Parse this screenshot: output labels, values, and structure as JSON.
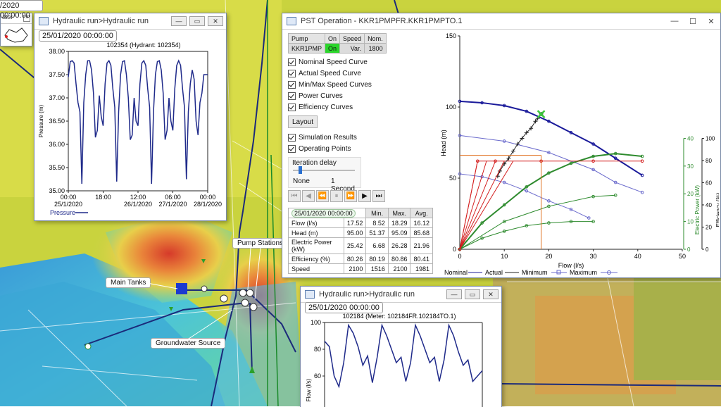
{
  "map": {
    "labels": {
      "pump_stations": "Pump Stations",
      "main_tanks": "Main Tanks",
      "groundwater_source": "Groundwater Source"
    },
    "partial_window": {
      "title_fragment": "ator",
      "date_fragment": "/2020 00:00:00"
    }
  },
  "hydrant_window": {
    "title": "Hydraulic run>Hydraulic run",
    "date": "25/01/2020 00:00:00",
    "chart_title": "102354 (Hydrant: 102354)",
    "legend": "Pressure"
  },
  "meter_window": {
    "title": "Hydraulic run>Hydraulic run",
    "date": "25/01/2020 00:00:00",
    "chart_title": "102184 (Meter: 102184FR.102184TO.1)"
  },
  "pst_window": {
    "title": "PST Operation - KKR1PMPFR.KKR1PMPTO.1",
    "pump_table": {
      "headers": [
        "Pump",
        "On",
        "Speed",
        "Nom."
      ],
      "row": [
        "KKR1PMP",
        "On",
        "Var.",
        "1800"
      ]
    },
    "checkboxes": [
      "Nominal Speed Curve",
      "Actual Speed Curve",
      "Min/Max Speed Curves",
      "Power Curves",
      "Efficiency Curves"
    ],
    "layout_button": "Layout",
    "checkboxes2": [
      "Simulation Results",
      "Operating Points"
    ],
    "iteration": {
      "label": "Iteration delay",
      "min_label": "None",
      "max_label": "1 Second",
      "value": 0.1
    },
    "results_table": {
      "date": "25/01/2020 00:00:00",
      "headers": [
        "Min.",
        "Max.",
        "Avg."
      ],
      "rows": [
        [
          "Flow (l/s)",
          "17.52",
          "8.52",
          "18.29",
          "16.12"
        ],
        [
          "Head (m)",
          "95.00",
          "51.37",
          "95.09",
          "85.68"
        ],
        [
          "Electric Power (kW)",
          "25.42",
          "6.68",
          "26.28",
          "21.96"
        ],
        [
          "Efficiency (%)",
          "80.26",
          "80.19",
          "80.86",
          "80.41"
        ],
        [
          "Speed",
          "2100",
          "1516",
          "2100",
          "1981"
        ]
      ]
    },
    "legend": {
      "nominal": "Nominal",
      "actual": "Actual",
      "minimum": "Minimum",
      "maximum": "Maximum"
    }
  },
  "colors": {
    "nominal": "#1a1a9a",
    "actual": "#222222",
    "minimum": "#6a6acc",
    "maximum": "#6a6acc",
    "power": "#2e8b2e",
    "efficiency": "#1a7a1a",
    "operating": "#d42020",
    "pressure": "#1f2a8a"
  },
  "chart_data": [
    {
      "type": "line",
      "title": "102354 (Hydrant: 102354)",
      "ylabel": "Pressure (m)",
      "ylim": [
        35.0,
        38.0
      ],
      "yticks": [
        "38.00",
        "37.50",
        "37.00",
        "36.50",
        "36.00",
        "35.50",
        "35.00"
      ],
      "xticks": [
        [
          "00:00",
          "25/1/2020"
        ],
        [
          "18:00",
          ""
        ],
        [
          "12:00",
          "26/1/2020"
        ],
        [
          "06:00",
          "27/1/2020"
        ],
        [
          "00:00",
          "28/1/2020"
        ]
      ],
      "xlim": [
        0,
        72
      ],
      "series": [
        {
          "name": "Pressure",
          "x": [
            0,
            1,
            2,
            3,
            4,
            5,
            6,
            7,
            8,
            9,
            10,
            11,
            12,
            13,
            14,
            15,
            16,
            17,
            18,
            19,
            20,
            21,
            22,
            23,
            24,
            25,
            26,
            27,
            28,
            29,
            30,
            31,
            32,
            33,
            34,
            35,
            36,
            37,
            38,
            39,
            40,
            41,
            42,
            43,
            44,
            45,
            46,
            47,
            48,
            49,
            50,
            51,
            52,
            53,
            54,
            55,
            56,
            57,
            58,
            59,
            60,
            61,
            62,
            63,
            64,
            65,
            66,
            67,
            68,
            69,
            70,
            71,
            72
          ],
          "y": [
            37.45,
            37.78,
            37.8,
            37.75,
            37.3,
            36.9,
            36.7,
            35.15,
            36.9,
            37.5,
            37.8,
            37.8,
            37.6,
            37.1,
            36.15,
            36.3,
            37.05,
            36.6,
            36.4,
            37.3,
            37.75,
            37.8,
            37.7,
            37.2,
            36.8,
            35.2,
            36.7,
            37.5,
            37.78,
            37.8,
            37.5,
            37.0,
            36.1,
            36.2,
            37.0,
            36.5,
            36.4,
            37.3,
            37.75,
            37.8,
            37.7,
            37.2,
            36.8,
            35.15,
            36.7,
            37.5,
            37.78,
            37.8,
            37.6,
            37.1,
            36.1,
            36.3,
            37.0,
            36.5,
            36.3,
            37.2,
            37.7,
            37.8,
            37.7,
            37.2,
            36.8,
            35.25,
            36.7,
            37.3,
            37.6,
            37.4,
            36.5,
            36.2,
            36.9,
            37.1,
            37.5,
            37.5,
            37.5
          ]
        }
      ]
    },
    {
      "type": "line",
      "title": "102184 (Meter: 102184FR.102184TO.1)",
      "ylabel": "Flow (l/s)",
      "ylim": [
        50,
        100
      ],
      "yticks": [
        "100",
        "80",
        "60"
      ],
      "series": [
        {
          "name": "Flow",
          "x": [
            0,
            2,
            4,
            6,
            8,
            10,
            12,
            14,
            16,
            18,
            20,
            22,
            24,
            26,
            28,
            30,
            32,
            34,
            36,
            38,
            40,
            42,
            44,
            46,
            48,
            50,
            52,
            54,
            56,
            58,
            60,
            62,
            64,
            66
          ],
          "y": [
            86,
            82,
            60,
            52,
            70,
            98,
            92,
            82,
            68,
            75,
            55,
            74,
            98,
            90,
            80,
            70,
            74,
            56,
            70,
            98,
            90,
            80,
            70,
            74,
            56,
            72,
            98,
            90,
            78,
            68,
            72,
            56,
            60,
            64
          ]
        }
      ]
    },
    {
      "type": "line",
      "xlabel": "Flow (l/s)",
      "ylabel": "Head (m)",
      "y2label": "Electric Power (kW)",
      "y3label": "Efficiency (%)",
      "xlim": [
        0,
        50
      ],
      "ylim": [
        0,
        150
      ],
      "y2lim": [
        0,
        40
      ],
      "y3lim": [
        0,
        100
      ],
      "xticks": [
        0,
        10,
        20,
        30,
        40,
        50
      ],
      "yticks": [
        0,
        50,
        100,
        150
      ],
      "y2ticks": [
        0,
        10,
        20,
        30,
        40
      ],
      "y3ticks": [
        0,
        20,
        40,
        60,
        80,
        100
      ],
      "legend_position": "bottom",
      "series": [
        {
          "name": "Nominal",
          "axis": "head",
          "x": [
            0,
            5,
            10,
            15,
            20,
            25,
            30,
            35,
            41
          ],
          "y": [
            104,
            103,
            101,
            97,
            90,
            82,
            74,
            64,
            52
          ]
        },
        {
          "name": "Minimum",
          "axis": "head",
          "x": [
            0,
            5,
            10,
            15,
            20,
            25,
            29
          ],
          "y": [
            53,
            51,
            47,
            41,
            34,
            28,
            22
          ]
        },
        {
          "name": "Maximum",
          "axis": "head",
          "x": [
            0,
            10,
            20,
            30,
            35,
            41
          ],
          "y": [
            80,
            76,
            68,
            56,
            47,
            40
          ]
        },
        {
          "name": "Actual Power",
          "axis": "power",
          "x": [
            0,
            5,
            10,
            15,
            20,
            25,
            30,
            35,
            41
          ],
          "y": [
            0,
            9.5,
            16,
            22.5,
            27.5,
            31,
            33.5,
            34.5,
            33.5
          ]
        },
        {
          "name": "Minimum Power",
          "axis": "power",
          "x": [
            0,
            5,
            10,
            15,
            20,
            25,
            30
          ],
          "y": [
            0,
            4,
            6.5,
            8.5,
            9.5,
            10,
            10
          ]
        },
        {
          "name": "Maximum Power",
          "axis": "power",
          "x": [
            0,
            10,
            20,
            30,
            35
          ],
          "y": [
            0,
            10,
            15.5,
            19,
            19.5
          ]
        },
        {
          "name": "Operating Head",
          "axis": "head",
          "x": [
            0,
            4,
            8,
            18.29,
            30,
            41
          ],
          "y": [
            0,
            62,
            62,
            62,
            62,
            62
          ]
        },
        {
          "name": "Operating Points",
          "axis": "head",
          "x": [
            8.52,
            9,
            10,
            11,
            12,
            13,
            14,
            15,
            16,
            17,
            17.52,
            18.29
          ],
          "y": [
            51.37,
            55,
            60,
            64,
            69,
            74,
            78,
            82,
            85,
            90,
            92,
            95.09
          ]
        }
      ],
      "current_point": {
        "flow": 18.29,
        "head": 66
      }
    }
  ]
}
